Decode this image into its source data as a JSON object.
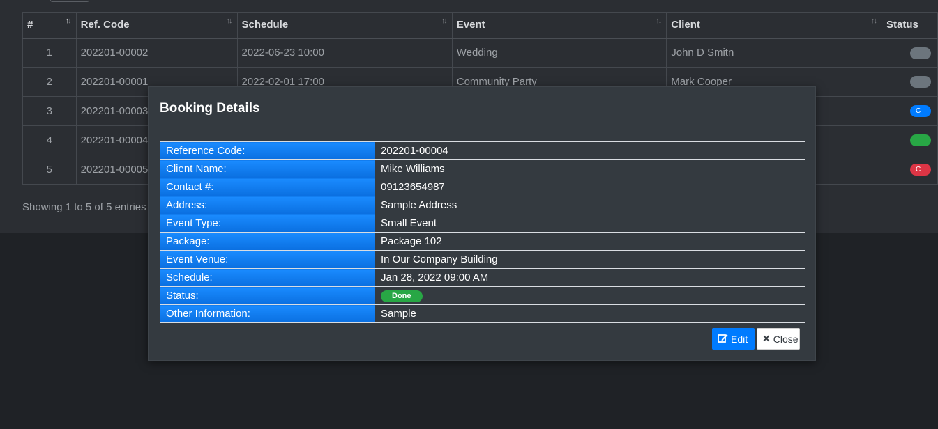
{
  "table": {
    "headers": [
      "#",
      "Ref. Code",
      "Schedule",
      "Event",
      "Client",
      "Status"
    ],
    "rows": [
      {
        "num": "1",
        "ref": "202201-00002",
        "schedule": "2022-06-23 10:00",
        "event": "Wedding",
        "client": "John D Smitn",
        "status_color": "#6c757d",
        "status_text": ""
      },
      {
        "num": "2",
        "ref": "202201-00001",
        "schedule": "2022-02-01 17:00",
        "event": "Community Party",
        "client": "Mark Cooper",
        "status_color": "#6c757d",
        "status_text": ""
      },
      {
        "num": "3",
        "ref": "202201-00003",
        "schedule": "",
        "event": "",
        "client": "",
        "status_color": "#007bff",
        "status_text": "C"
      },
      {
        "num": "4",
        "ref": "202201-00004",
        "schedule": "",
        "event": "",
        "client": "",
        "status_color": "#28a745",
        "status_text": ""
      },
      {
        "num": "5",
        "ref": "202201-00005",
        "schedule": "",
        "event": "",
        "client": "",
        "status_color": "#dc3545",
        "status_text": "C"
      }
    ],
    "showing": "Showing 1 to 5 of 5 entries"
  },
  "modal": {
    "title": "Booking Details",
    "details": [
      {
        "label": "Reference Code:",
        "value": "202201-00004"
      },
      {
        "label": "Client Name:",
        "value": "Mike Williams"
      },
      {
        "label": "Contact #:",
        "value": "09123654987"
      },
      {
        "label": "Address:",
        "value": "Sample Address"
      },
      {
        "label": "Event Type:",
        "value": "Small Event"
      },
      {
        "label": "Package:",
        "value": "Package 102"
      },
      {
        "label": "Event Venue:",
        "value": "In Our Company Building"
      },
      {
        "label": "Schedule:",
        "value": "Jan 28, 2022 09:00 AM"
      },
      {
        "label": "Status:",
        "value": "Done"
      },
      {
        "label": "Other Information:",
        "value": "Sample"
      }
    ],
    "edit_label": "Edit",
    "close_label": "Close",
    "status_color": "#28a745"
  },
  "icons": {
    "edit": "edit-icon",
    "close": "close-icon",
    "sort": "sort-icon"
  }
}
